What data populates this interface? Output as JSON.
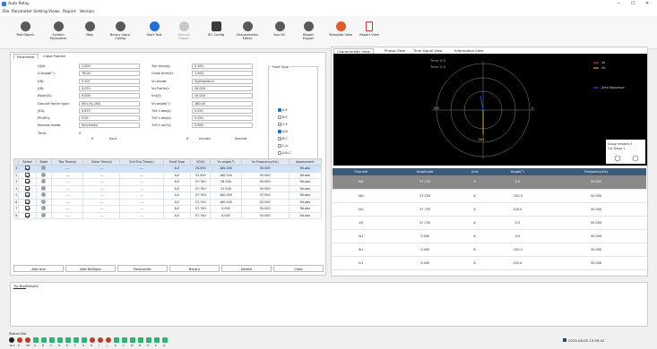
{
  "window": {
    "title": "Auto Relay",
    "min": "−",
    "max": "☐",
    "close": "✕"
  },
  "menu": [
    "File",
    "Parameter Setting",
    "Views",
    "Report",
    "Version"
  ],
  "toolbar": [
    {
      "label": "Test Object",
      "color": "#5a5a5a"
    },
    {
      "label": "System\nParameter",
      "color": "#5a5a5a"
    },
    {
      "label": "Map",
      "color": "#5a5a5a"
    },
    {
      "label": "Binary input\nConfig",
      "color": "#5a5a5a"
    },
    {
      "label": "Start Test",
      "color": "#1e6fe0"
    },
    {
      "label": "Manual\nTrigger",
      "color": "#b8b8b8"
    },
    {
      "label": "IEC Config",
      "color": "#3d3d3d"
    },
    {
      "label": "Characteristic\nEditor",
      "color": "#5a5a5a"
    },
    {
      "label": "Aux DC",
      "color": "#5a5a5a"
    },
    {
      "label": "Report\nExport",
      "color": "#5a5a5a"
    },
    {
      "label": "Template View",
      "color": "#e05a2a"
    },
    {
      "label": "Report View",
      "color": "#5a5a5a"
    }
  ],
  "left_tabs": [
    "Parameter",
    "Close Publish"
  ],
  "params_left": [
    {
      "label": "U(N):",
      "value": "1.000"
    },
    {
      "label": "U Angle(°):",
      "value": "78.00"
    },
    {
      "label": "I(N):",
      "value": "0.207"
    },
    {
      "label": "I(B):",
      "value": "0.070"
    },
    {
      "label": "IFault(A):",
      "value": "9.000"
    },
    {
      "label": "Ground Factor type:",
      "value": "|K0| |%| |K0|"
    },
    {
      "label": "|K0|:",
      "value": "0.670"
    },
    {
      "label": "Phi(K0):",
      "value": "0.00"
    },
    {
      "label": "Reclose mode:",
      "value": "Successful"
    },
    {
      "label": "Time:",
      "value": "0"
    }
  ],
  "params_right": [
    {
      "label": "Trip time(s):",
      "value": "0.100"
    },
    {
      "label": "Close time(s):",
      "value": "1.000"
    },
    {
      "label": "Vn mode:",
      "value": "Synthesize A"
    },
    {
      "label": "Vn Fre(Hz):",
      "value": "50.000"
    },
    {
      "label": "Vn(V):",
      "value": "10.000"
    },
    {
      "label": "Vn angle(°):",
      "value": "180.00"
    },
    {
      "label": "Td1 t abs(s):",
      "value": "0.020"
    },
    {
      "label": "Td2 t abs(s):",
      "value": "0.020"
    },
    {
      "label": "Td3 t rel(%):",
      "value": "2.000"
    }
  ],
  "time_units": {
    "hour": "hour",
    "minute": "minute",
    "second": "Second",
    "min_val": "0",
    "sec_val": "0"
  },
  "fault_type": {
    "title": "Fault Type",
    "options": [
      {
        "label": "A-E",
        "checked": true
      },
      {
        "label": "B-E",
        "checked": false
      },
      {
        "label": "C-E",
        "checked": false
      },
      {
        "label": "A-B",
        "checked": true
      },
      {
        "label": "B-C",
        "checked": false
      },
      {
        "label": "C-A",
        "checked": false
      },
      {
        "label": "A-B-C",
        "checked": false
      }
    ]
  },
  "grid": {
    "headers": [
      "",
      "Select",
      "State",
      "Trip Time(s)",
      "Close Time(s)",
      "2nd Trip Time(s)",
      "Fault Type",
      "V0(V)",
      "Vn angle(°)",
      "Vn Frequency(Hz)",
      "Assessment"
    ],
    "rows": [
      [
        "1",
        "---",
        "---",
        "---",
        "A-E",
        "28.500",
        "180.000",
        "50.000",
        "ToLabs"
      ],
      [
        "2",
        "---",
        "---",
        "---",
        "A-E",
        "31.500",
        "180.000",
        "50.000",
        "ToLabs"
      ],
      [
        "3",
        "---",
        "---",
        "---",
        "A-E",
        "57.740",
        "28.500",
        "50.000",
        "ToLabs"
      ],
      [
        "4",
        "---",
        "---",
        "---",
        "A-E",
        "57.740",
        "31.500",
        "50.000",
        "ToLabs"
      ],
      [
        "5",
        "---",
        "---",
        "---",
        "A-E",
        "57.740",
        "180.000",
        "47.500",
        "ToLabs"
      ],
      [
        "6",
        "---",
        "---",
        "---",
        "A-E",
        "57.740",
        "180.000",
        "52.500",
        "ToLabs"
      ],
      [
        "7",
        "---",
        "---",
        "---",
        "A-E",
        "57.740",
        "0.000",
        "50.000",
        "ToLabs"
      ],
      [
        "8",
        "---",
        "---",
        "---",
        "A-E",
        "57.740",
        "0.000",
        "50.000",
        "ToLabs"
      ]
    ]
  },
  "buttons": [
    "Add one",
    "Add Multiple",
    "Parameter",
    "Binary",
    "Delete",
    "Clear"
  ],
  "right_tabs": [
    "Characteristic View",
    "Phasor View",
    "Time Signal View",
    "Information View"
  ],
  "scope": {
    "time1": "Time: 0.0",
    "time2": "Time: 0.0",
    "legend": [
      "Va",
      "Vb",
      "Zero Sequence"
    ],
    "legend_colors": [
      "#ff3a2a",
      "#ffd21a",
      "#2a55ff"
    ],
    "axis_left": "180",
    "axis_right": "0",
    "cursor_label": "Va1",
    "popup_line1": "Group mentors 0",
    "popup_line2": "Cur Group 1"
  },
  "phasor": {
    "headers": [
      "Channel",
      "Amplitude",
      "Unit",
      "Angle(°)",
      "Frequency(Hz)"
    ],
    "rows": [
      [
        "Va1",
        "57.735",
        "V",
        "0.0",
        "50.000"
      ],
      [
        "Vb1",
        "57.735",
        "V",
        "-120.0",
        "50.000"
      ],
      [
        "Vc1",
        "57.735",
        "V",
        "120.0",
        "50.000"
      ],
      [
        "V0",
        "57.735",
        "V",
        "0.0",
        "50.000"
      ],
      [
        "Ia1",
        "0.000",
        "A",
        "0.0",
        "50.000"
      ],
      [
        "Ib1",
        "0.000",
        "A",
        "-120.0",
        "50.000"
      ],
      [
        "Ic1",
        "0.000",
        "A",
        "120.0",
        "50.000"
      ]
    ]
  },
  "bottom_tabs": [
    "Tip Box",
    "Results"
  ],
  "status": {
    "title": "Status Bar",
    "led_labels": [
      "Run",
      "P",
      "Wt",
      "A",
      "B",
      "C",
      "D",
      "E",
      "F",
      "G",
      "H",
      "I",
      "J",
      "K",
      "L",
      "M",
      "N",
      "O",
      "P",
      "Q"
    ],
    "datetime": "2025-08-05 13:39:42"
  }
}
